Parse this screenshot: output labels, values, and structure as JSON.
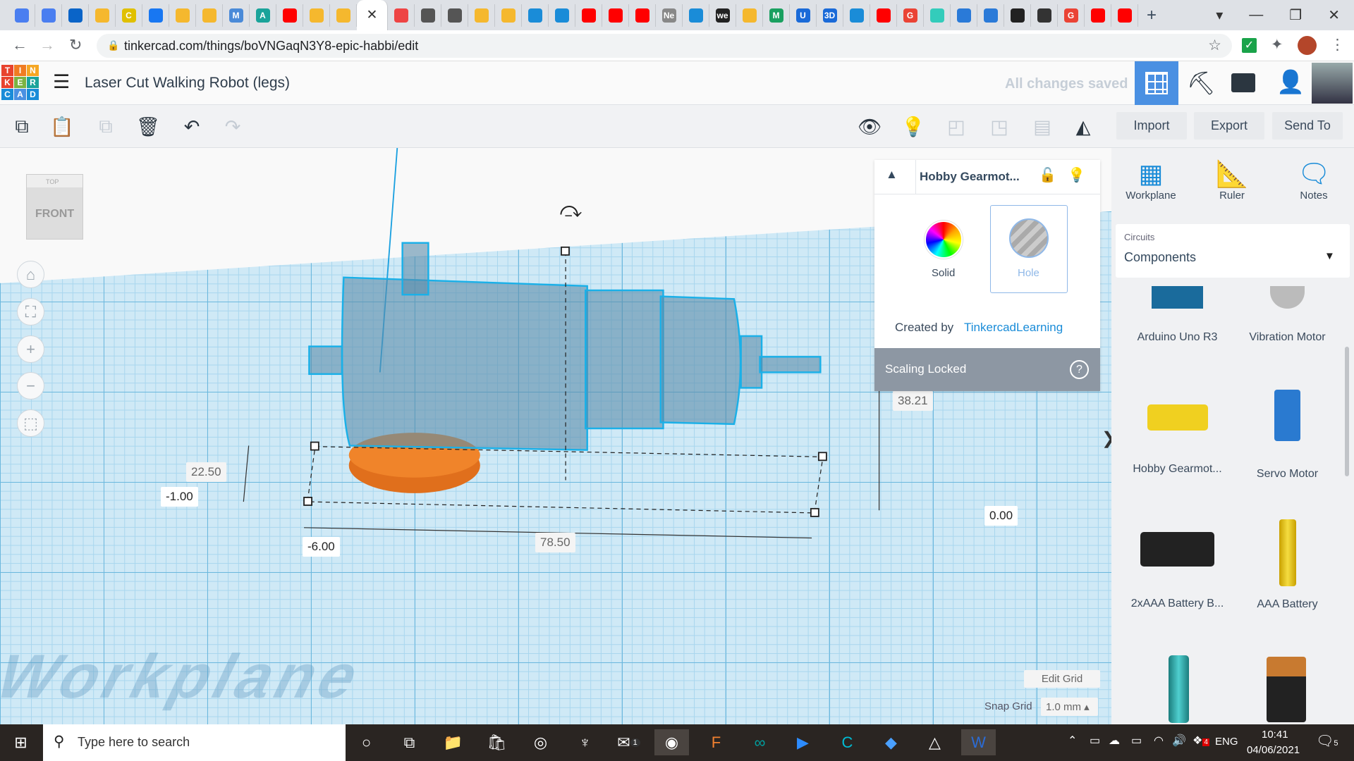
{
  "browser": {
    "tab_icons": [
      "google-translate",
      "google-translate",
      "outlook",
      "robot",
      "c-logo",
      "facebook",
      "robot",
      "robot",
      "m-hex",
      "autodesk",
      "youtube",
      "robot",
      "robot",
      "close-active",
      "tinkercad",
      "globe",
      "globe",
      "robot",
      "robot",
      "t-circle",
      "t-circle",
      "youtube",
      "youtube",
      "youtube",
      "ne",
      "t-circle",
      "we",
      "robot",
      "m-green",
      "u-blue",
      "3d",
      "t-circle",
      "youtube",
      "google",
      "cube",
      "layers",
      "layers",
      "italic",
      "bug",
      "google",
      "youtube",
      "youtube"
    ],
    "tab_texts": {
      "ne": "Ne",
      "we": "we",
      "m-green": "M",
      "u-blue": "U",
      "3d": "3D",
      "google": "G",
      "c-logo": "C",
      "m-hex": "M",
      "autodesk": "A"
    },
    "new_tab": "+",
    "url": "tinkercad.com/things/boVNGaqN3Y8-epic-habbi/edit"
  },
  "app": {
    "logo_letters": [
      "T",
      "I",
      "N",
      "K",
      "E",
      "R",
      "C",
      "A",
      "D"
    ],
    "title": "Laser Cut Walking Robot (legs)",
    "save_status": "All changes saved"
  },
  "toolbar": {
    "import": "Import",
    "export": "Export",
    "send_to": "Send To"
  },
  "viewcube": {
    "top": "TOP",
    "front": "FRONT"
  },
  "dimensions": {
    "height": "22.50",
    "elevation": "-1.00",
    "x_offset": "-6.00",
    "length": "78.50",
    "z_height": "38.21",
    "y_pos": "0.00"
  },
  "inspector": {
    "name": "Hobby Gearmot...",
    "solid": "Solid",
    "hole": "Hole",
    "created_by": "Created by",
    "author": "TinkercadLearning",
    "scaling": "Scaling Locked",
    "help": "?"
  },
  "grid": {
    "edit": "Edit Grid",
    "snap_label": "Snap Grid",
    "snap_value": "1.0 mm"
  },
  "workplane_text": "Workplane",
  "right_tools": [
    {
      "label": "Workplane"
    },
    {
      "label": "Ruler"
    },
    {
      "label": "Notes"
    }
  ],
  "library": {
    "category": "Circuits",
    "selected": "Components"
  },
  "components": [
    "Arduino Uno R3",
    "Vibration Motor",
    "Hobby Gearmot...",
    "Servo Motor",
    "2xAAA Battery B...",
    "AAA Battery"
  ],
  "taskbar": {
    "search_placeholder": "Type here to search",
    "lang": "ENG",
    "time": "10:41",
    "date": "04/06/2021",
    "notif_count": "5",
    "dropbox_badge": "4",
    "mail_badge": "1"
  },
  "colors": {
    "accent": "#1a8cd8",
    "orange": "#f07c22",
    "ui_blue": "#4a90e2"
  }
}
